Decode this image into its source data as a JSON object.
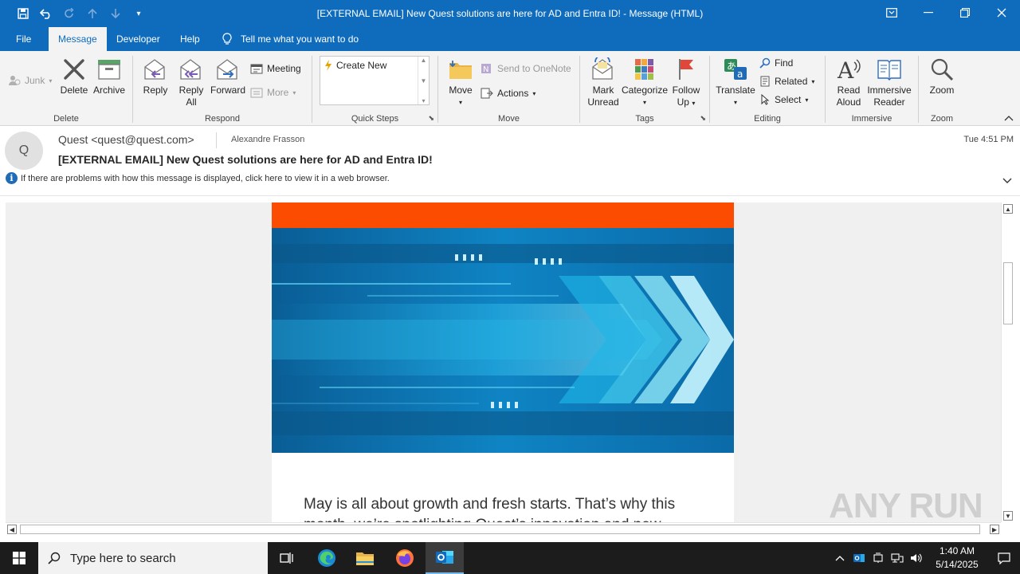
{
  "window": {
    "title": "[EXTERNAL EMAIL] New Quest solutions are here for AD and Entra ID!  -  Message (HTML)"
  },
  "tabs": [
    {
      "label": "File"
    },
    {
      "label": "Message"
    },
    {
      "label": "Developer"
    },
    {
      "label": "Help"
    }
  ],
  "tellme": {
    "label": "Tell me what you want to do"
  },
  "ribbon": {
    "delete_group": {
      "label": "Delete",
      "junk": "Junk",
      "delete": "Delete",
      "archive": "Archive"
    },
    "respond_group": {
      "label": "Respond",
      "reply": "Reply",
      "reply_all_1": "Reply",
      "reply_all_2": "All",
      "forward": "Forward",
      "meeting": "Meeting",
      "more": "More"
    },
    "quicksteps_group": {
      "label": "Quick Steps",
      "create_new": "Create New"
    },
    "move_group": {
      "label": "Move",
      "move": "Move",
      "onenote": "Send to OneNote",
      "actions": "Actions"
    },
    "tags_group": {
      "label": "Tags",
      "mark_unread_1": "Mark",
      "mark_unread_2": "Unread",
      "categorize": "Categorize",
      "follow_up_1": "Follow",
      "follow_up_2": "Up"
    },
    "editing_group": {
      "label": "Editing",
      "translate": "Translate",
      "find": "Find",
      "related": "Related",
      "select": "Select"
    },
    "immersive_group": {
      "label": "Immersive",
      "read_aloud_1": "Read",
      "read_aloud_2": "Aloud",
      "immersive_reader_1": "Immersive",
      "immersive_reader_2": "Reader"
    },
    "zoom_group": {
      "label": "Zoom",
      "zoom": "Zoom"
    }
  },
  "message": {
    "avatar_initial": "Q",
    "sender": "Quest <quest@quest.com>",
    "to": "Alexandre Frasson",
    "date": "Tue 4:51 PM",
    "subject": "[EXTERNAL EMAIL] New Quest solutions are here for AD and Entra ID!",
    "info": "If there are problems with how this message is displayed, click here to view it in a web browser.",
    "body_text": "May is all about growth and fresh starts. That’s why this month, we’re spotlighting Quest’s innovation and new"
  },
  "watermark": "ANY RUN",
  "taskbar": {
    "search_placeholder": "Type here to search",
    "time": "1:40 AM",
    "date": "5/14/2025"
  },
  "colors": {
    "accent": "#0f6cbd",
    "orange": "#fc4c02",
    "taskbar": "#1c1c1c"
  }
}
